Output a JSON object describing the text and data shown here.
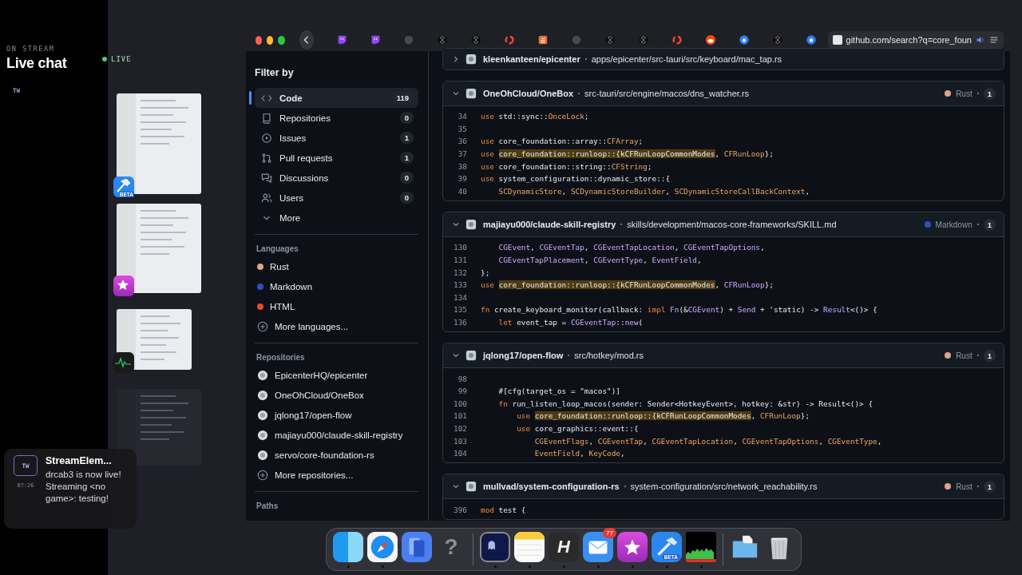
{
  "chat": {
    "eyebrow": "ON STREAM",
    "title": "Live chat",
    "badge": "TW",
    "live": "LIVE"
  },
  "thumbnails": [
    {
      "kind": "hammer",
      "label": "BETA"
    },
    {
      "kind": "star"
    },
    {
      "kind": "pulse"
    },
    {
      "kind": "faded"
    }
  ],
  "browser": {
    "tabs": [
      {
        "kind": "twitch",
        "selected": false
      },
      {
        "kind": "twitch",
        "selected": false
      },
      {
        "kind": "round",
        "selected": false
      },
      {
        "kind": "knot",
        "selected": false
      },
      {
        "kind": "knot",
        "selected": false
      },
      {
        "kind": "ring",
        "selected": false
      },
      {
        "kind": "stack",
        "selected": false
      },
      {
        "kind": "round",
        "selected": false
      },
      {
        "kind": "knot",
        "selected": false
      },
      {
        "kind": "knot",
        "selected": false
      },
      {
        "kind": "ring",
        "selected": false
      },
      {
        "kind": "alien",
        "selected": false
      },
      {
        "kind": "dot",
        "selected": false
      },
      {
        "kind": "knot",
        "selected": false
      },
      {
        "kind": "dot",
        "selected": false
      },
      {
        "kind": "page",
        "selected": true,
        "url": "github.com/search?q=core_foun"
      }
    ]
  },
  "sidebar": {
    "title": "Filter by",
    "types": [
      {
        "kind": "code",
        "label": "Code",
        "count": "119",
        "selected": true
      },
      {
        "kind": "repo",
        "label": "Repositories",
        "count": "0",
        "selected": false
      },
      {
        "kind": "issue",
        "label": "Issues",
        "count": "1",
        "selected": false
      },
      {
        "kind": "pr",
        "label": "Pull requests",
        "count": "1",
        "selected": false
      },
      {
        "kind": "discussion",
        "label": "Discussions",
        "count": "0",
        "selected": false
      },
      {
        "kind": "users",
        "label": "Users",
        "count": "0",
        "selected": false
      },
      {
        "kind": "chevron",
        "label": "More",
        "selected": false
      }
    ],
    "languages_title": "Languages",
    "languages": [
      {
        "label": "Rust",
        "color": "#dea584"
      },
      {
        "label": "Markdown",
        "color": "#2f4fc4"
      },
      {
        "label": "HTML",
        "color": "#e34c26"
      }
    ],
    "more_languages": "More languages...",
    "repos_title": "Repositories",
    "repos": [
      "EpicenterHQ/epicenter",
      "OneOhCloud/OneBox",
      "jqlong17/open-flow",
      "majiayu000/claude-skill-registry",
      "servo/core-foundation-rs"
    ],
    "more_repos": "More repositories...",
    "paths_title": "Paths"
  },
  "results": [
    {
      "expanded": false,
      "repo": "kleenkanteen/epicenter",
      "path": "apps/epicenter/src-tauri/src/keyboard/mac_tap.rs"
    },
    {
      "expanded": true,
      "repo": "OneOhCloud/OneBox",
      "path": "src-tauri/src/engine/macos/dns_watcher.rs",
      "language": "Rust",
      "color": "#dea584",
      "count": "1",
      "lines": [
        {
          "n": "34",
          "parts": [
            {
              "text": "use",
              "kind": "keyword"
            },
            {
              "text": " std::sync::",
              "kind": "plain"
            },
            {
              "text": "OnceLock",
              "kind": "type"
            },
            {
              "text": ";",
              "kind": "plain"
            }
          ]
        },
        {
          "n": "35"
        },
        {
          "n": "36",
          "parts": [
            {
              "text": "use",
              "kind": "keyword"
            },
            {
              "text": " core_foundation::array::",
              "kind": "plain"
            },
            {
              "text": "CFArray",
              "kind": "type"
            },
            {
              "text": ";",
              "kind": "plain"
            }
          ]
        },
        {
          "n": "37",
          "parts": [
            {
              "text": "use ",
              "kind": "keyword"
            },
            {
              "text": "core_foundation::runloop::{kCFRunLoopCommonModes",
              "kind": "match"
            },
            {
              "text": ", ",
              "kind": "plain"
            },
            {
              "text": "CFRunLoop",
              "kind": "type"
            },
            {
              "text": "};",
              "kind": "plain"
            }
          ]
        },
        {
          "n": "38",
          "parts": [
            {
              "text": "use",
              "kind": "keyword"
            },
            {
              "text": " core_foundation::string::",
              "kind": "plain"
            },
            {
              "text": "CFString",
              "kind": "type"
            },
            {
              "text": ";",
              "kind": "plain"
            }
          ]
        },
        {
          "n": "39",
          "parts": [
            {
              "text": "use",
              "kind": "keyword"
            },
            {
              "text": " system_configuration::dynamic_store::{",
              "kind": "plain"
            }
          ]
        },
        {
          "n": "40",
          "parts": [
            {
              "text": "    SCDynamicStore",
              "kind": "type"
            },
            {
              "text": ", ",
              "kind": "plain"
            },
            {
              "text": "SCDynamicStoreBuilder",
              "kind": "type"
            },
            {
              "text": ", ",
              "kind": "plain"
            },
            {
              "text": "SCDynamicStoreCallBackContext",
              "kind": "type"
            },
            {
              "text": ",",
              "kind": "plain"
            }
          ]
        }
      ]
    },
    {
      "expanded": true,
      "repo": "majiayu000/claude-skill-registry",
      "path": "skills/development/macos-core-frameworks/SKILL.md",
      "language": "Markdown",
      "color": "#2f4fc4",
      "count": "1",
      "lines": [
        {
          "n": "130",
          "parts": [
            {
              "text": "    CGEvent",
              "kind": "function"
            },
            {
              "text": ", ",
              "kind": "plain"
            },
            {
              "text": "CGEventTap",
              "kind": "function"
            },
            {
              "text": ", ",
              "kind": "plain"
            },
            {
              "text": "CGEventTapLocation",
              "kind": "function"
            },
            {
              "text": ", ",
              "kind": "plain"
            },
            {
              "text": "CGEventTapOptions",
              "kind": "function"
            },
            {
              "text": ",",
              "kind": "plain"
            }
          ]
        },
        {
          "n": "131",
          "parts": [
            {
              "text": "    CGEventTapPlacement",
              "kind": "function"
            },
            {
              "text": ", ",
              "kind": "plain"
            },
            {
              "text": "CGEventType",
              "kind": "function"
            },
            {
              "text": ", ",
              "kind": "plain"
            },
            {
              "text": "EventField",
              "kind": "function"
            },
            {
              "text": ",",
              "kind": "plain"
            }
          ]
        },
        {
          "n": "132",
          "parts": [
            {
              "text": "};",
              "kind": "plain"
            }
          ]
        },
        {
          "n": "133",
          "parts": [
            {
              "text": "use ",
              "kind": "keyword"
            },
            {
              "text": "core_foundation::runloop::{kCFRunLoopCommonModes",
              "kind": "match"
            },
            {
              "text": ", ",
              "kind": "plain"
            },
            {
              "text": "CFRunLoop",
              "kind": "function"
            },
            {
              "text": "};",
              "kind": "plain"
            }
          ]
        },
        {
          "n": "134"
        },
        {
          "n": "135",
          "parts": [
            {
              "text": "fn",
              "kind": "keyword"
            },
            {
              "text": " create_keyboard_monitor(callback: ",
              "kind": "plain"
            },
            {
              "text": "impl",
              "kind": "keyword"
            },
            {
              "text": " Fn",
              "kind": "function"
            },
            {
              "text": "(&",
              "kind": "plain"
            },
            {
              "text": "CGEvent",
              "kind": "function"
            },
            {
              "text": ") + ",
              "kind": "plain"
            },
            {
              "text": "Send",
              "kind": "function"
            },
            {
              "text": " + 'static) -> ",
              "kind": "plain"
            },
            {
              "text": "Result",
              "kind": "function"
            },
            {
              "text": "<()> {",
              "kind": "plain"
            }
          ]
        },
        {
          "n": "136",
          "parts": [
            {
              "text": "    let",
              "kind": "keyword"
            },
            {
              "text": " event_tap = ",
              "kind": "plain"
            },
            {
              "text": "CGEventTap",
              "kind": "function"
            },
            {
              "text": "::",
              "kind": "plain"
            },
            {
              "text": "new",
              "kind": "function"
            },
            {
              "text": "(",
              "kind": "plain"
            }
          ]
        }
      ]
    },
    {
      "expanded": true,
      "repo": "jqlong17/open-flow",
      "path": "src/hotkey/mod.rs",
      "language": "Rust",
      "color": "#dea584",
      "count": "1",
      "lines": [
        {
          "n": "98"
        },
        {
          "n": "99",
          "parts": [
            {
              "text": "    #[cfg(target_os = \"macos\")]",
              "kind": "plain"
            }
          ]
        },
        {
          "n": "100",
          "parts": [
            {
              "text": "    fn",
              "kind": "keyword"
            },
            {
              "text": " run_listen_loop_macos(sender: Sender<HotkeyEvent>, hotkey: &str) -> Result<()> {",
              "kind": "plain"
            }
          ]
        },
        {
          "n": "101",
          "parts": [
            {
              "text": "        use ",
              "kind": "keyword"
            },
            {
              "text": "core_foundation::runloop::{kCFRunLoopCommonModes",
              "kind": "match"
            },
            {
              "text": ", ",
              "kind": "plain"
            },
            {
              "text": "CFRunLoop",
              "kind": "type"
            },
            {
              "text": "};",
              "kind": "plain"
            }
          ]
        },
        {
          "n": "102",
          "parts": [
            {
              "text": "        use",
              "kind": "keyword"
            },
            {
              "text": " core_graphics::event::{",
              "kind": "plain"
            }
          ]
        },
        {
          "n": "103",
          "parts": [
            {
              "text": "            CGEventFlags",
              "kind": "type"
            },
            {
              "text": ", ",
              "kind": "plain"
            },
            {
              "text": "CGEventTap",
              "kind": "type"
            },
            {
              "text": ", ",
              "kind": "plain"
            },
            {
              "text": "CGEventTapLocation",
              "kind": "type"
            },
            {
              "text": ", ",
              "kind": "plain"
            },
            {
              "text": "CGEventTapOptions",
              "kind": "type"
            },
            {
              "text": ", ",
              "kind": "plain"
            },
            {
              "text": "CGEventType",
              "kind": "type"
            },
            {
              "text": ",",
              "kind": "plain"
            }
          ]
        },
        {
          "n": "104",
          "parts": [
            {
              "text": "            EventField",
              "kind": "type"
            },
            {
              "text": ", ",
              "kind": "plain"
            },
            {
              "text": "KeyCode",
              "kind": "type"
            },
            {
              "text": ",",
              "kind": "plain"
            }
          ]
        }
      ]
    },
    {
      "expanded": true,
      "repo": "mullvad/system-configuration-rs",
      "path": "system-configuration/src/network_reachability.rs",
      "language": "Rust",
      "color": "#dea584",
      "count": "1",
      "lines": [
        {
          "n": "396",
          "parts": [
            {
              "text": "mod",
              "kind": "keyword"
            },
            {
              "text": " test {",
              "kind": "plain"
            }
          ]
        }
      ]
    }
  ],
  "notification": {
    "badge": "TW",
    "time": "07:26",
    "title": "StreamElem...",
    "body": "drcab3 is now live! Streaming <no game>: testing!"
  },
  "dock": {
    "sections": [
      [
        {
          "kind": "finder",
          "running": true
        },
        {
          "kind": "compass",
          "running": true
        },
        {
          "kind": "pages",
          "running": false
        },
        {
          "kind": "question",
          "glyph": "?",
          "running": false
        }
      ],
      [
        {
          "kind": "terminal",
          "running": true
        },
        {
          "kind": "notes",
          "running": true
        },
        {
          "kind": "h",
          "glyph": "H",
          "running": true
        },
        {
          "kind": "mail",
          "badge": "77",
          "running": true
        },
        {
          "kind": "star",
          "running": true
        },
        {
          "kind": "hammer",
          "label": "BETA",
          "running": true
        },
        {
          "kind": "meter",
          "running": true
        }
      ],
      [
        {
          "kind": "folder",
          "running": false
        },
        {
          "kind": "trash",
          "running": false
        }
      ]
    ]
  }
}
